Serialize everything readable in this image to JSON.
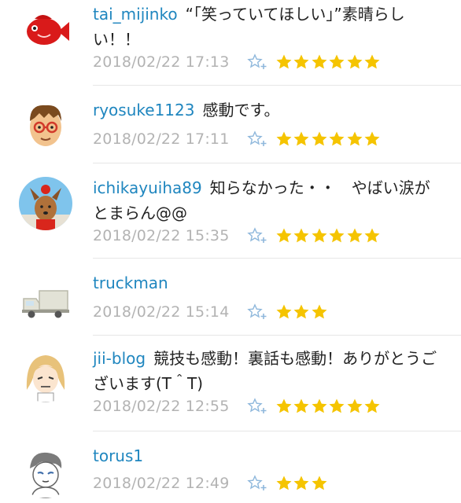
{
  "comments": [
    {
      "user": "tai_mijinko",
      "text": "“「笑っていてほしい」”素晴らしい！！",
      "time": "2018/02/22 17:13",
      "stars": 6,
      "avatar": "red-fish-avatar"
    },
    {
      "user": "ryosuke1123",
      "text": "感動です。",
      "time": "2018/02/22 17:11",
      "stars": 6,
      "avatar": "boy-glasses-avatar"
    },
    {
      "user": "ichikayuiha89",
      "text": "知らなかった・・　やばい涙がとまらん@@",
      "time": "2018/02/22 15:35",
      "stars": 6,
      "avatar": "dog-avatar"
    },
    {
      "user": "truckman",
      "text": "",
      "time": "2018/02/22 15:14",
      "stars": 3,
      "avatar": "truck-avatar"
    },
    {
      "user": "jii-blog",
      "text": "競技も感動！裏話も感動！ありがとうございます(T＾T)",
      "time": "2018/02/22 12:55",
      "stars": 6,
      "avatar": "blonde-girl-avatar"
    },
    {
      "user": "torus1",
      "text": "",
      "time": "2018/02/22 12:49",
      "stars": 3,
      "avatar": "sketch-person-avatar"
    }
  ],
  "colors": {
    "star": "#f5c400",
    "username": "#1f86bf",
    "timestamp": "#b3b3b3"
  }
}
